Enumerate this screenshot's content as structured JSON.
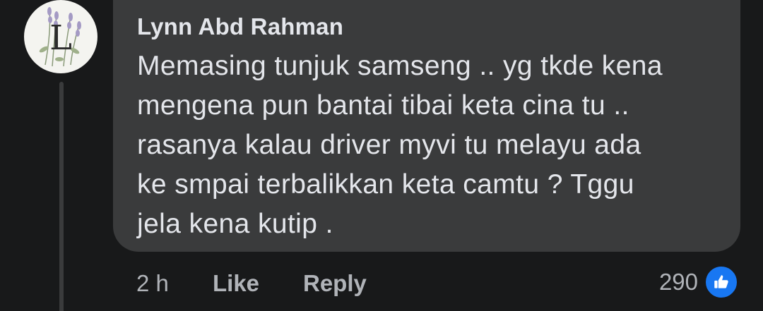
{
  "comment": {
    "author": "Lynn Abd Rahman",
    "avatar_letter": "L",
    "text_lines": [
      "Memasing tunjuk samseng .. yg tkde kena",
      "mengena pun bantai tibai keta cina tu ..",
      "rasanya kalau driver myvi tu melayu ada",
      "ke smpai terbalikkan keta camtu ? Tggu",
      "jela kena kutip ."
    ],
    "timestamp": "2 h",
    "like_label": "Like",
    "reply_label": "Reply",
    "reaction_count": "290",
    "reaction_icon": "thumbs-up-icon"
  },
  "colors": {
    "background": "#18191a",
    "bubble": "#3a3b3c",
    "text": "#e4e6eb",
    "secondary_text": "#b0b3b8",
    "like_blue": "#1877f2"
  }
}
